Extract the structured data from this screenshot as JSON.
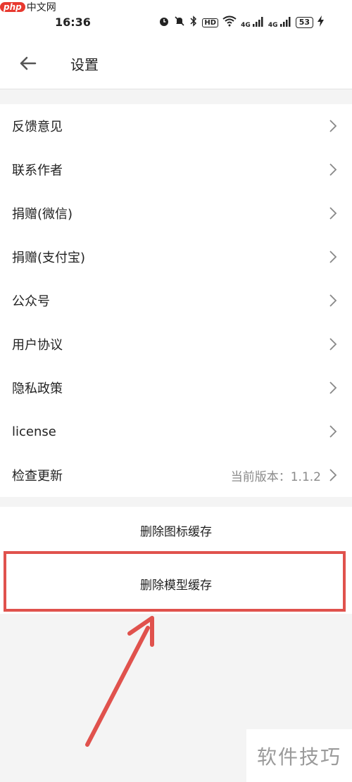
{
  "watermark_top": {
    "brand": "php",
    "site": "中文网"
  },
  "status_bar": {
    "time": "16:36",
    "icons": [
      "alarm-icon",
      "mute-icon",
      "bluetooth-icon",
      "hd-icon",
      "wifi-icon",
      "signal-icon",
      "signal-icon",
      "battery-icon",
      "charging-icon"
    ],
    "hd_label": "HD",
    "signal_label_1": "4G",
    "signal_label_2": "4G",
    "battery_level": "53"
  },
  "header": {
    "title": "设置",
    "back_icon": "arrow-left-icon"
  },
  "menu": {
    "items": [
      {
        "label": "反馈意见"
      },
      {
        "label": "联系作者"
      },
      {
        "label": "捐赠(微信)"
      },
      {
        "label": "捐赠(支付宝)"
      },
      {
        "label": "公众号"
      },
      {
        "label": "用户协议"
      },
      {
        "label": "隐私政策"
      },
      {
        "label": "license"
      },
      {
        "label": "检查更新",
        "value": "当前版本：1.1.2"
      }
    ]
  },
  "actions": {
    "delete_icon_cache": "删除图标缓存",
    "delete_model_cache": "删除模型缓存"
  },
  "annotation": {
    "highlight_color": "#e0524d"
  },
  "watermark_bottom": {
    "text": "软件技巧"
  }
}
